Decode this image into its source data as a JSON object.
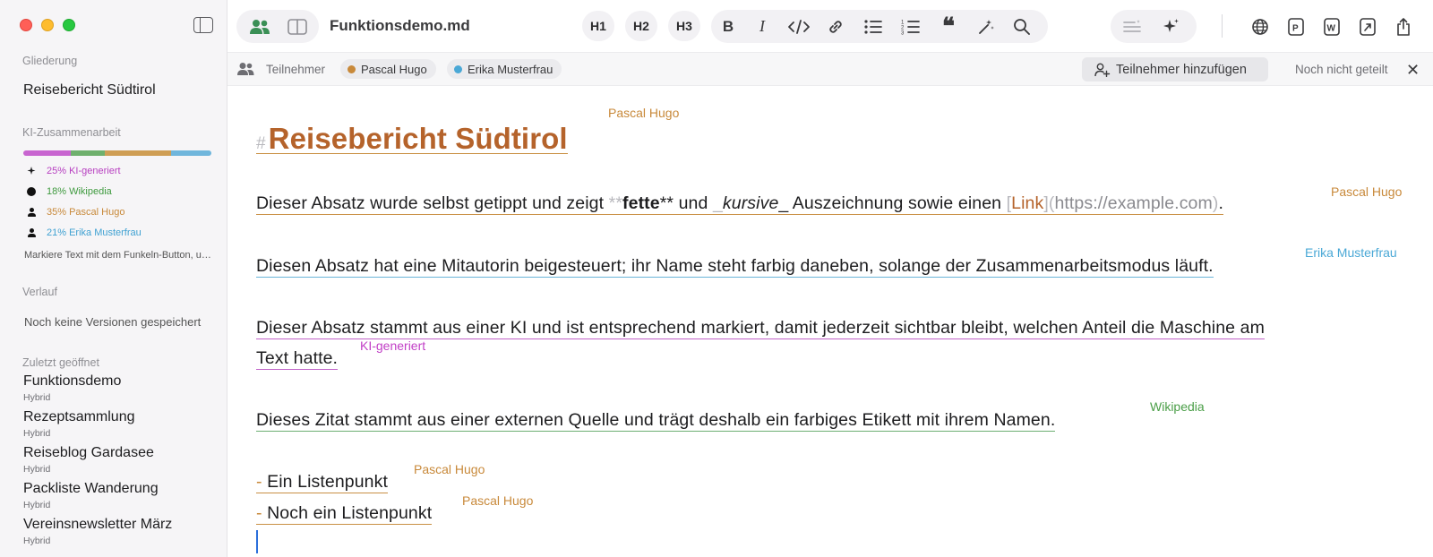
{
  "sidebar": {
    "outline_heading": "Gliederung",
    "outline_item": "Reisebericht Südtirol",
    "ai_heading": "KI-Zusammenarbeit",
    "contribution_bar": [
      {
        "label": "KI",
        "fraction": 0.25,
        "color": "#c865d0"
      },
      {
        "label": "Wikipedia",
        "fraction": 0.18,
        "color": "#6fb06d"
      },
      {
        "label": "Pascal Hugo",
        "fraction": 0.35,
        "color": "#cf9e55"
      },
      {
        "label": "Erika Musterfrau",
        "fraction": 0.21,
        "color": "#70b6dc"
      }
    ],
    "stats": [
      {
        "label": "25% KI-generiert",
        "icon": "sparkle-icon",
        "color": "#b73fc0"
      },
      {
        "label": "18% Wikipedia",
        "icon": "circle-icon",
        "color": "#3f9a3f"
      },
      {
        "label": "35% Pascal Hugo",
        "icon": "person-icon",
        "color": "#c8893a"
      },
      {
        "label": "21% Erika Musterfrau",
        "icon": "person-icon",
        "color": "#3fa1d2"
      }
    ],
    "hint": "Markiere Text mit dem Funkeln-Button, um ihn als KI-generiert zu kennzeichnen.",
    "history_heading": "Verlauf",
    "history_empty": "Noch keine Versionen gespeichert",
    "recent_heading": "Zuletzt geöffnet",
    "recent": [
      {
        "title": "Funktionsdemo",
        "mode": "Hybrid"
      },
      {
        "title": "Rezeptsammlung",
        "mode": "Hybrid"
      },
      {
        "title": "Reiseblog Gardasee",
        "mode": "Hybrid"
      },
      {
        "title": "Packliste Wanderung",
        "mode": "Hybrid"
      },
      {
        "title": "Vereinsnewsletter März",
        "mode": "Hybrid"
      }
    ]
  },
  "toolbar": {
    "document_name": "Funktionsdemo.md",
    "h1": "H1",
    "h2": "H2",
    "h3": "H3"
  },
  "collab": {
    "label": "Teilnehmer",
    "participants": [
      {
        "name": "Pascal Hugo",
        "color": "#c8893a"
      },
      {
        "name": "Erika Musterfrau",
        "color": "#4aa8d6"
      }
    ],
    "add_button": "Teilnehmer hinzufügen",
    "share_status": "Noch nicht geteilt"
  },
  "editor": {
    "heading": "Reisebericht Südtirol",
    "heading_author": "Pascal Hugo",
    "p1": {
      "before_bold": "Dieser Absatz wurde selbst getippt und zeigt ",
      "bold_marker": "**",
      "bold": "fette",
      "bold_marker_end": "**",
      "between": " und ",
      "italic_marker": "_",
      "italic": "kursive",
      "italic_marker_end": "_",
      "after_italic": " Auszeichnung sowie einen ",
      "link_open": "[",
      "link_text": "Link",
      "link_mid": "](",
      "url": "https://example.com",
      "link_close": ")",
      "end": ".",
      "author": "Pascal Hugo"
    },
    "p2": {
      "text": "Diesen Absatz hat eine Mitautorin beigesteuert; ihr Name steht farbig daneben, solange der Zusammenarbeitsmodus läuft.",
      "author": "Erika Musterfrau"
    },
    "p3": {
      "line1": "Dieser Absatz stammt aus einer KI und ist entsprechend markiert, damit jederzeit sichtbar bleibt, welchen Anteil die Maschine am",
      "line2": "Text hatte.",
      "author": "KI-generiert"
    },
    "p4": {
      "text": "Dieses Zitat stammt aus einer externen Quelle und trägt deshalb ein farbiges Etikett mit ihrem Namen.",
      "author": "Wikipedia"
    },
    "list": [
      {
        "marker": "-",
        "text": "Ein Listenpunkt",
        "author": "Pascal Hugo"
      },
      {
        "marker": "-",
        "text": "Noch ein Listenpunkt",
        "author": "Pascal Hugo"
      }
    ]
  }
}
